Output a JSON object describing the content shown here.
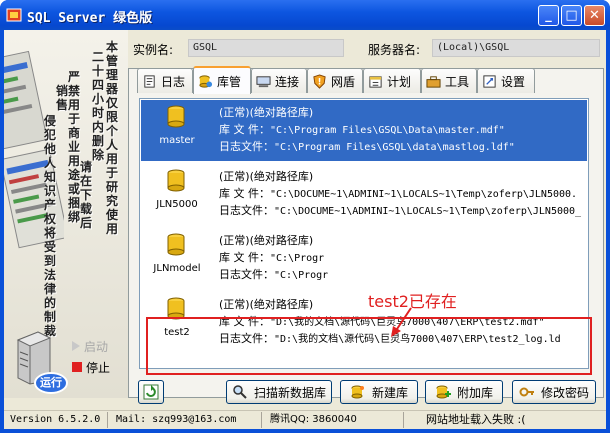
{
  "window": {
    "title": "SQL Server 绿色版",
    "min_label": "_",
    "max_label": "□",
    "close_label": "✕"
  },
  "banner": {
    "notice_columns": [
      "本管理器仅限个人用于研究使用",
      "请在下载后",
      "二十四小时内删除",
      "严禁用于商业用途或捆绑",
      "销售",
      "侵犯他人知识产权将受到法律的制裁"
    ],
    "run_label": "运行",
    "start_label": "启动",
    "stop_label": "停止"
  },
  "header": {
    "instance_label": "实例名:",
    "instance_value": "GSQL",
    "server_label": "服务器名:",
    "server_value": "(Local)\\GSQL"
  },
  "tabs": [
    {
      "label": "日志",
      "icon": "log-icon"
    },
    {
      "label": "库管",
      "icon": "database-manage-icon",
      "active": true
    },
    {
      "label": "连接",
      "icon": "connection-icon"
    },
    {
      "label": "网盾",
      "icon": "shield-icon"
    },
    {
      "label": "计划",
      "icon": "schedule-icon"
    },
    {
      "label": "工具",
      "icon": "toolbox-icon"
    },
    {
      "label": "设置",
      "icon": "settings-icon"
    }
  ],
  "databases": [
    {
      "name": "master",
      "status": "(正常)(绝对路径库)",
      "db_label": "库 文 件：",
      "db_file": "\"C:\\Program Files\\GSQL\\Data\\master.mdf\"",
      "log_label": "日志文件：",
      "log_file": "\"C:\\Program Files\\GSQL\\data\\mastlog.ldf\"",
      "selected": true
    },
    {
      "name": "JLN5000",
      "status": "(正常)(绝对路径库)",
      "db_label": "库 文 件：",
      "db_file": "\"C:\\DOCUME~1\\ADMINI~1\\LOCALS~1\\Temp\\zoferp\\JLN5000.",
      "log_label": "日志文件：",
      "log_file": "\"C:\\DOCUME~1\\ADMINI~1\\LOCALS~1\\Temp\\zoferp\\JLN5000_"
    },
    {
      "name": "JLNmodel",
      "status": "(正常)(绝对路径库)",
      "db_label": "库 文 件：",
      "db_file": "\"C:\\Progr",
      "log_label": "日志文件：",
      "log_file": "\"C:\\Progr"
    },
    {
      "name": "test2",
      "status": "(正常)(绝对路径库)",
      "db_label": "库 文 件：",
      "db_file": "\"D:\\我的文档\\源代码\\巨灵鸟7000\\407\\ERP\\test2.mdf\"",
      "log_label": "日志文件：",
      "log_file": "\"D:\\我的文档\\源代码\\巨灵鸟7000\\407\\ERP\\test2_log.ld"
    }
  ],
  "annotation": "test2已存在",
  "buttons": {
    "refresh_icon": "refresh-icon",
    "scan_label": "扫描新数据库",
    "create_label": "新建库",
    "attach_label": "附加库",
    "password_label": "修改密码"
  },
  "status": {
    "version": "Version 6.5.2.0",
    "mail": "Mail: szq993@163.com",
    "qq": "腾讯QQ: 3860040",
    "net": "网站地址载入失败 :("
  },
  "colors": {
    "title": "#0a50d8",
    "selection": "#316ac5",
    "annotation": "#e02020"
  }
}
